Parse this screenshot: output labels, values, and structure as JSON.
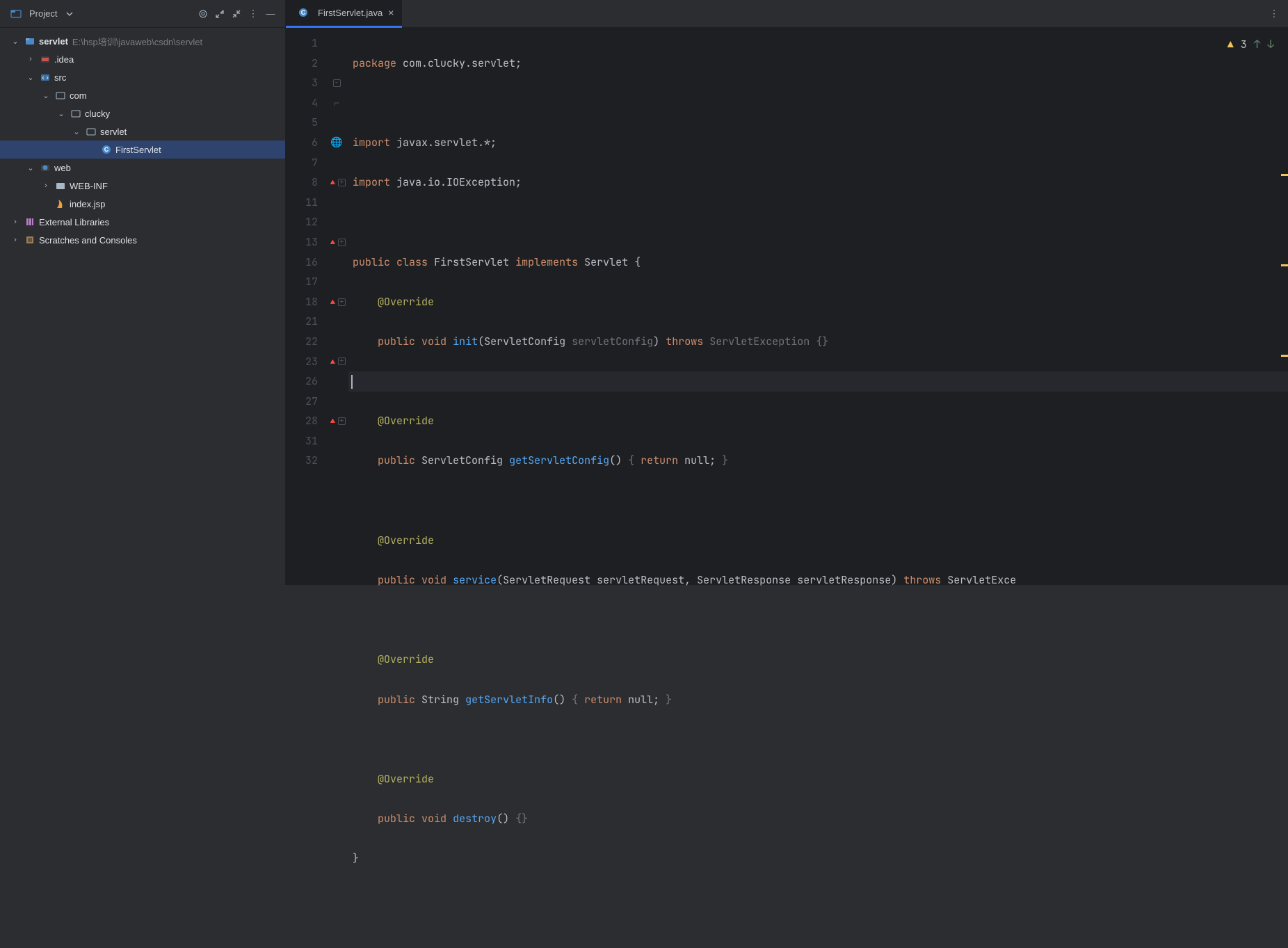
{
  "sidebar": {
    "title": "Project",
    "tree": {
      "root": "servlet",
      "root_path": "E:\\hsp培训\\javaweb\\csdn\\servlet",
      "idea": ".idea",
      "src": "src",
      "com": "com",
      "clucky": "clucky",
      "servlet_pkg": "servlet",
      "first_servlet": "FirstServlet",
      "web": "web",
      "webinf": "WEB-INF",
      "index_jsp": "index.jsp",
      "ext_lib": "External Libraries",
      "scratches": "Scratches and Consoles"
    }
  },
  "tabs": {
    "file": "FirstServlet.java"
  },
  "inspector": {
    "warnings": "3"
  },
  "gutter_lines": [
    "1",
    "2",
    "3",
    "4",
    "5",
    "6",
    "7",
    "8",
    "11",
    "12",
    "13",
    "16",
    "17",
    "18",
    "21",
    "22",
    "23",
    "26",
    "27",
    "28",
    "31",
    "32"
  ],
  "code": {
    "l1": {
      "kw": "package",
      "rest": " com.clucky.servlet;"
    },
    "l3": {
      "kw": "import",
      "rest": " javax.servlet.*;"
    },
    "l4": {
      "kw": "import",
      "rest": " java.io.IOException;"
    },
    "l6": {
      "kw1": "public",
      "kw2": "class",
      "cls": "FirstServlet",
      "kw3": "implements",
      "iface": "Servlet",
      "brace": " {"
    },
    "override": "@Override",
    "l8": {
      "kw1": "public",
      "kw2": "void",
      "m": "init",
      "p1t": "ServletConfig",
      "p1n": "servletConfig",
      "kw3": "throws",
      "ex": "ServletException",
      "body": " {}"
    },
    "l13": {
      "kw1": "public",
      "ret": "ServletConfig",
      "m": "getServletConfig",
      "body_open": "{ ",
      "kw_ret": "return",
      "val": " null; ",
      "body_close": "}"
    },
    "l18": {
      "kw1": "public",
      "kw2": "void",
      "m": "service",
      "p1t": "ServletRequest",
      "p1n": "servletRequest",
      "p2t": "ServletResponse",
      "p2n": "servletResponse",
      "kw3": "throws",
      "ex": "ServletExce"
    },
    "l23": {
      "kw1": "public",
      "ret": "String",
      "m": "getServletInfo",
      "body_open": "{ ",
      "kw_ret": "return",
      "val": " null; ",
      "body_close": "}"
    },
    "l28": {
      "kw1": "public",
      "kw2": "void",
      "m": "destroy",
      "body": " {}"
    },
    "l31": "}"
  }
}
